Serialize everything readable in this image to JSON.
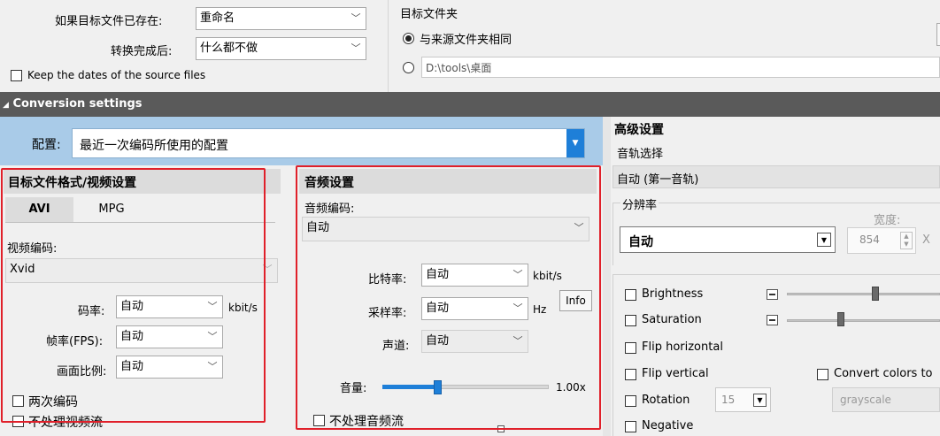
{
  "top": {
    "exists_label": "如果目标文件已存在:",
    "exists_value": "重命名",
    "after_label": "转换完成后:",
    "after_value": "什么都不做",
    "keep_dates": "Keep the dates of the source files",
    "target_folder_title": "目标文件夹",
    "same_as_source": "与来源文件夹相同",
    "folder_path": "D:\\tools\\桌面"
  },
  "conversion_settings": {
    "title": "Conversion settings",
    "profile_label": "配置:",
    "profile_value": "最近一次编码所使用的配置"
  },
  "video": {
    "title": "目标文件格式/视频设置",
    "tabs": [
      "AVI",
      "MPG"
    ],
    "codec_label": "视频编码:",
    "codec_value": "Xvid",
    "bitrate_label": "码率:",
    "bitrate_value": "自动",
    "bitrate_unit": "kbit/s",
    "fps_label": "帧率(FPS):",
    "fps_value": "自动",
    "aspect_label": "画面比例:",
    "aspect_value": "自动",
    "two_pass": "两次编码",
    "skip_video": "不处理视频流"
  },
  "audio": {
    "title": "音频设置",
    "codec_label": "音频编码:",
    "codec_value": "自动",
    "bitrate_label": "比特率:",
    "bitrate_value": "自动",
    "bitrate_unit": "kbit/s",
    "info_button": "Info",
    "samplerate_label": "采样率:",
    "samplerate_value": "自动",
    "samplerate_unit": "Hz",
    "channels_label": "声道:",
    "channels_value": "自动",
    "volume_label": "音量:",
    "volume_value": "1.00x",
    "skip_audio": "不处理音频流"
  },
  "advanced": {
    "title": "高级设置",
    "track_label": "音轨选择",
    "track_value": "自动 (第一音轨)",
    "resolution_label": "分辨率",
    "resolution_value": "自动",
    "width_label": "宽度:",
    "width_value": "854",
    "x_symbol": "X",
    "brightness": "Brightness",
    "saturation": "Saturation",
    "flip_horizontal": "Flip horizontal",
    "flip_vertical": "Flip vertical",
    "rotation": "Rotation",
    "rotation_value": "15",
    "negative": "Negative",
    "convert_colors": "Convert colors to",
    "color_mode": "grayscale"
  },
  "colors": {
    "highlight_box": "#e0202a",
    "header_bar": "#5a5a5a",
    "profile_band": "#a9cbe8",
    "dropdown_button": "#1e7fd8",
    "volume_fill": "#1e7fd8"
  }
}
